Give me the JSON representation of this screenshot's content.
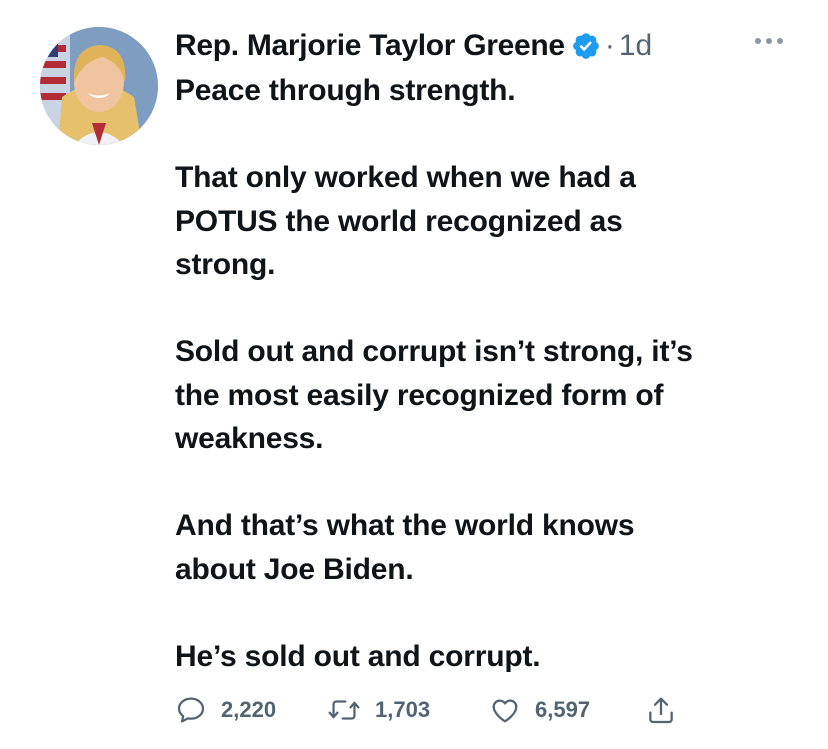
{
  "tweet": {
    "author_name": "Rep. Marjorie Taylor Greene",
    "separator": "·",
    "timestamp": "1d",
    "paragraphs": [
      "Peace through strength.",
      "That only worked when we had a\nPOTUS the world recognized as\nstrong.",
      "Sold out and corrupt isn’t strong, it’s\nthe most easily recognized form of\nweakness.",
      "And that’s what the world knows\nabout Joe Biden.",
      "He’s sold out and corrupt."
    ],
    "replies": "2,220",
    "retweets": "1,703",
    "likes": "6,597"
  },
  "icons": {
    "verified": "verified-badge-icon",
    "more": "more-horizontal-icon",
    "reply": "reply-bubble-icon",
    "retweet": "retweet-icon",
    "like": "heart-icon",
    "share": "share-icon"
  },
  "colors": {
    "text": "#0f1419",
    "secondary": "#536471",
    "verified": "#1d9bf0"
  }
}
